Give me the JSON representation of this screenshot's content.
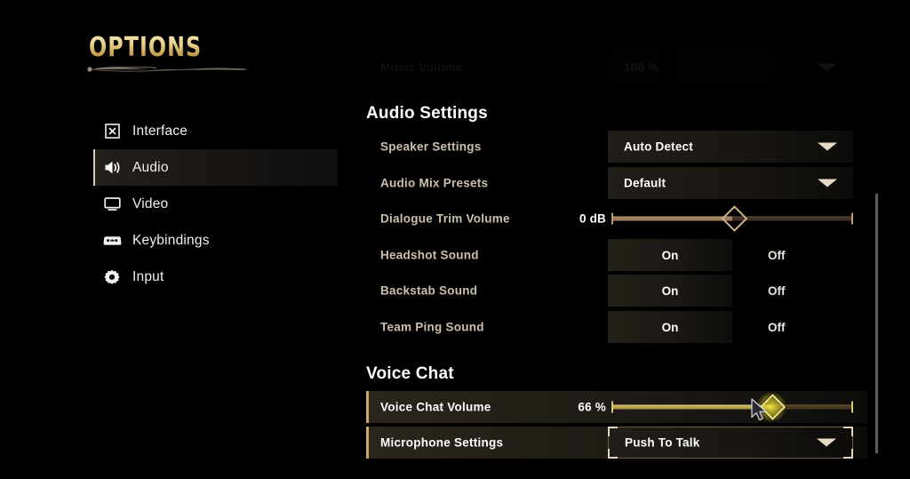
{
  "title": "OPTIONS",
  "sidebar": {
    "items": [
      {
        "label": "Interface",
        "icon": "interface-icon",
        "selected": false
      },
      {
        "label": "Audio",
        "icon": "audio-icon",
        "selected": true
      },
      {
        "label": "Video",
        "icon": "video-icon",
        "selected": false
      },
      {
        "label": "Keybindings",
        "icon": "keybindings-icon",
        "selected": false
      },
      {
        "label": "Input",
        "icon": "input-gear-icon",
        "selected": false
      }
    ]
  },
  "scrolled_row": {
    "label": "Music Volume",
    "value": "100 %"
  },
  "sections": {
    "audio_settings": {
      "title": "Audio Settings",
      "rows": {
        "speaker_settings": {
          "label": "Speaker Settings",
          "value": "Auto Detect"
        },
        "audio_mix_presets": {
          "label": "Audio Mix Presets",
          "value": "Default"
        },
        "dialogue_trim_volume": {
          "label": "Dialogue Trim Volume",
          "value": "0 dB",
          "percent": 50
        },
        "headshot_sound": {
          "label": "Headshot Sound",
          "on": "On",
          "off": "Off",
          "selected": "On"
        },
        "backstab_sound": {
          "label": "Backstab Sound",
          "on": "On",
          "off": "Off",
          "selected": "On"
        },
        "team_ping_sound": {
          "label": "Team Ping Sound",
          "on": "On",
          "off": "Off",
          "selected": "On"
        }
      }
    },
    "voice_chat": {
      "title": "Voice Chat",
      "rows": {
        "voice_chat_volume": {
          "label": "Voice Chat Volume",
          "value": "66 %",
          "percent": 66
        },
        "microphone_settings": {
          "label": "Microphone Settings",
          "value": "Push To Talk"
        }
      }
    }
  },
  "colors": {
    "gold": "#e8cf86",
    "label_tan": "#cdbfab",
    "slider_tan": "#cdb18a",
    "slider_gold": "#cbb55c",
    "accent_bar": "#c9a96a"
  }
}
